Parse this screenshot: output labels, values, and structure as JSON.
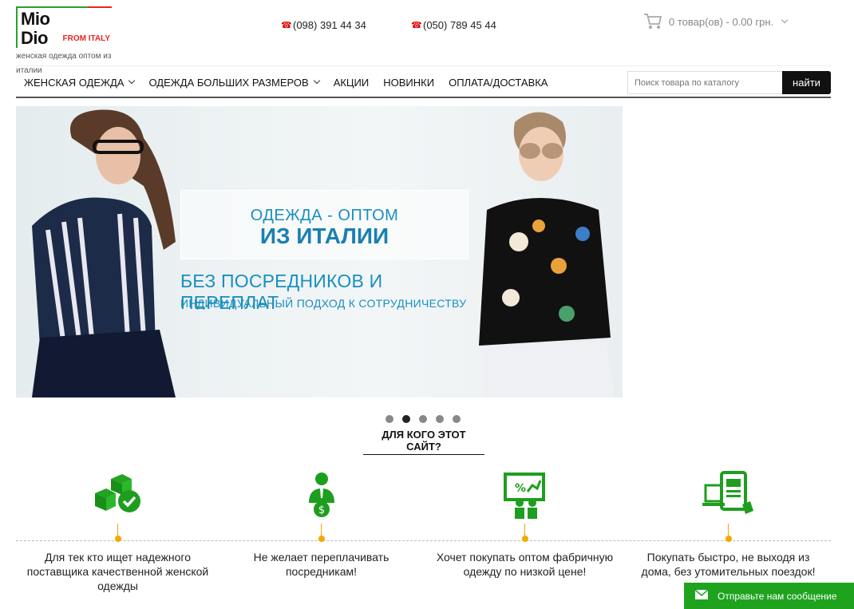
{
  "header": {
    "logo_text": "Mio Dio",
    "logo_suffix": "FROM ITALY",
    "tagline": "женская одежда оптом из италии",
    "phones": [
      "(098) 391 44 34",
      "(050) 789 45 44"
    ],
    "cart_text": "0 товар(ов) - 0.00 грн."
  },
  "nav": {
    "items": [
      {
        "label": "ЖЕНСКАЯ ОДЕЖДА",
        "dropdown": true
      },
      {
        "label": "ОДЕЖДА БОЛЬШИХ РАЗМЕРОВ",
        "dropdown": true
      },
      {
        "label": "АКЦИИ",
        "dropdown": false
      },
      {
        "label": "НОВИНКИ",
        "dropdown": false
      },
      {
        "label": "ОПЛАТА/ДОСТАВКА",
        "dropdown": false
      }
    ],
    "search_placeholder": "Поиск товара по каталогу",
    "search_button": "найти"
  },
  "banner": {
    "line1": "ОДЕЖДА - ОПТОМ",
    "line2": "ИЗ ИТАЛИИ",
    "line3": "БЕЗ ПОСРЕДНИКОВ И ПЕРЕПЛАТ",
    "line4": "ИНДИВИДУАЛЬНЫЙ ПОДХОД К СОТРУДНИЧЕСТВУ",
    "slides": 5,
    "active_slide": 2
  },
  "who_title": "ДЛЯ КОГО ЭТОТ САЙТ?",
  "features": [
    {
      "icon": "boxes-check-icon",
      "text": "Для тек кто ищет надежного поставщика качественной женской одежды"
    },
    {
      "icon": "businessman-money-icon",
      "text": "Не желает переплачивать посредникам!"
    },
    {
      "icon": "presentation-discount-icon",
      "text": "Хочет покупать оптом фабричную одежду по низкой цене!"
    },
    {
      "icon": "devices-shopping-icon",
      "text": "Покупать быстро, не выходя из дома, без утомительных поездок!"
    }
  ],
  "chat": {
    "label": "Отправьте нам сообщение"
  },
  "colors": {
    "accent_green": "#1fa31f",
    "banner_blue": "#1a8fbf",
    "stem_orange": "#f2a900"
  }
}
